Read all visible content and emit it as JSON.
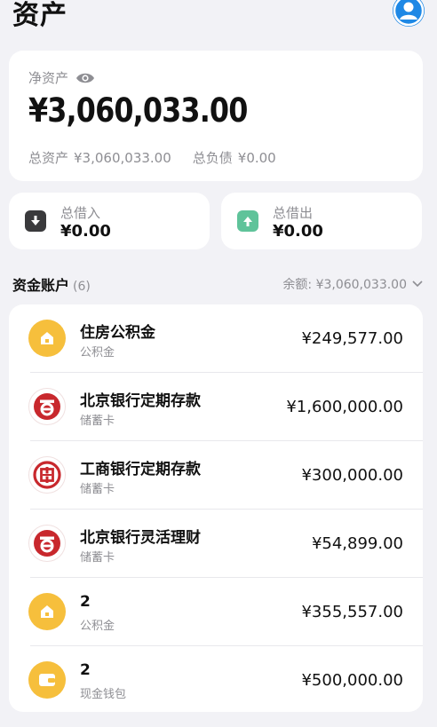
{
  "header": {
    "title": "资产"
  },
  "net_assets": {
    "label": "净资产",
    "value": "¥3,060,033.00",
    "total_assets_label": "总资产",
    "total_assets_value": "¥3,060,033.00",
    "total_liabilities_label": "总负债",
    "total_liabilities_value": "¥0.00"
  },
  "borrow_in": {
    "label": "总借入",
    "value": "¥0.00"
  },
  "borrow_out": {
    "label": "总借出",
    "value": "¥0.00"
  },
  "accounts_section": {
    "title": "资金账户",
    "count": "(6)",
    "balance": "余额: ¥3,060,033.00"
  },
  "accounts": [
    {
      "name": "住房公积金",
      "type": "公积金",
      "amount": "¥249,577.00",
      "icon": "housing-fund-icon"
    },
    {
      "name": "北京银行定期存款",
      "type": "储蓄卡",
      "amount": "¥1,600,000.00",
      "icon": "bank-of-beijing-icon"
    },
    {
      "name": "工商银行定期存款",
      "type": "储蓄卡",
      "amount": "¥300,000.00",
      "icon": "icbc-icon"
    },
    {
      "name": "北京银行灵活理财",
      "type": "储蓄卡",
      "amount": "¥54,899.00",
      "icon": "bank-of-beijing-icon"
    },
    {
      "name": "2",
      "type": "公积金",
      "amount": "¥355,557.00",
      "icon": "housing-fund-icon"
    },
    {
      "name": "2",
      "type": "现金钱包",
      "amount": "¥500,000.00",
      "icon": "wallet-icon"
    }
  ],
  "colors": {
    "background": "#f2f2f6",
    "avatar": "#1e88e5",
    "borrow_in_icon": "#3a3a3c",
    "borrow_out_icon": "#5fc39a",
    "housing_fund": "#f6bf3c",
    "bank_red": "#c8282d"
  }
}
